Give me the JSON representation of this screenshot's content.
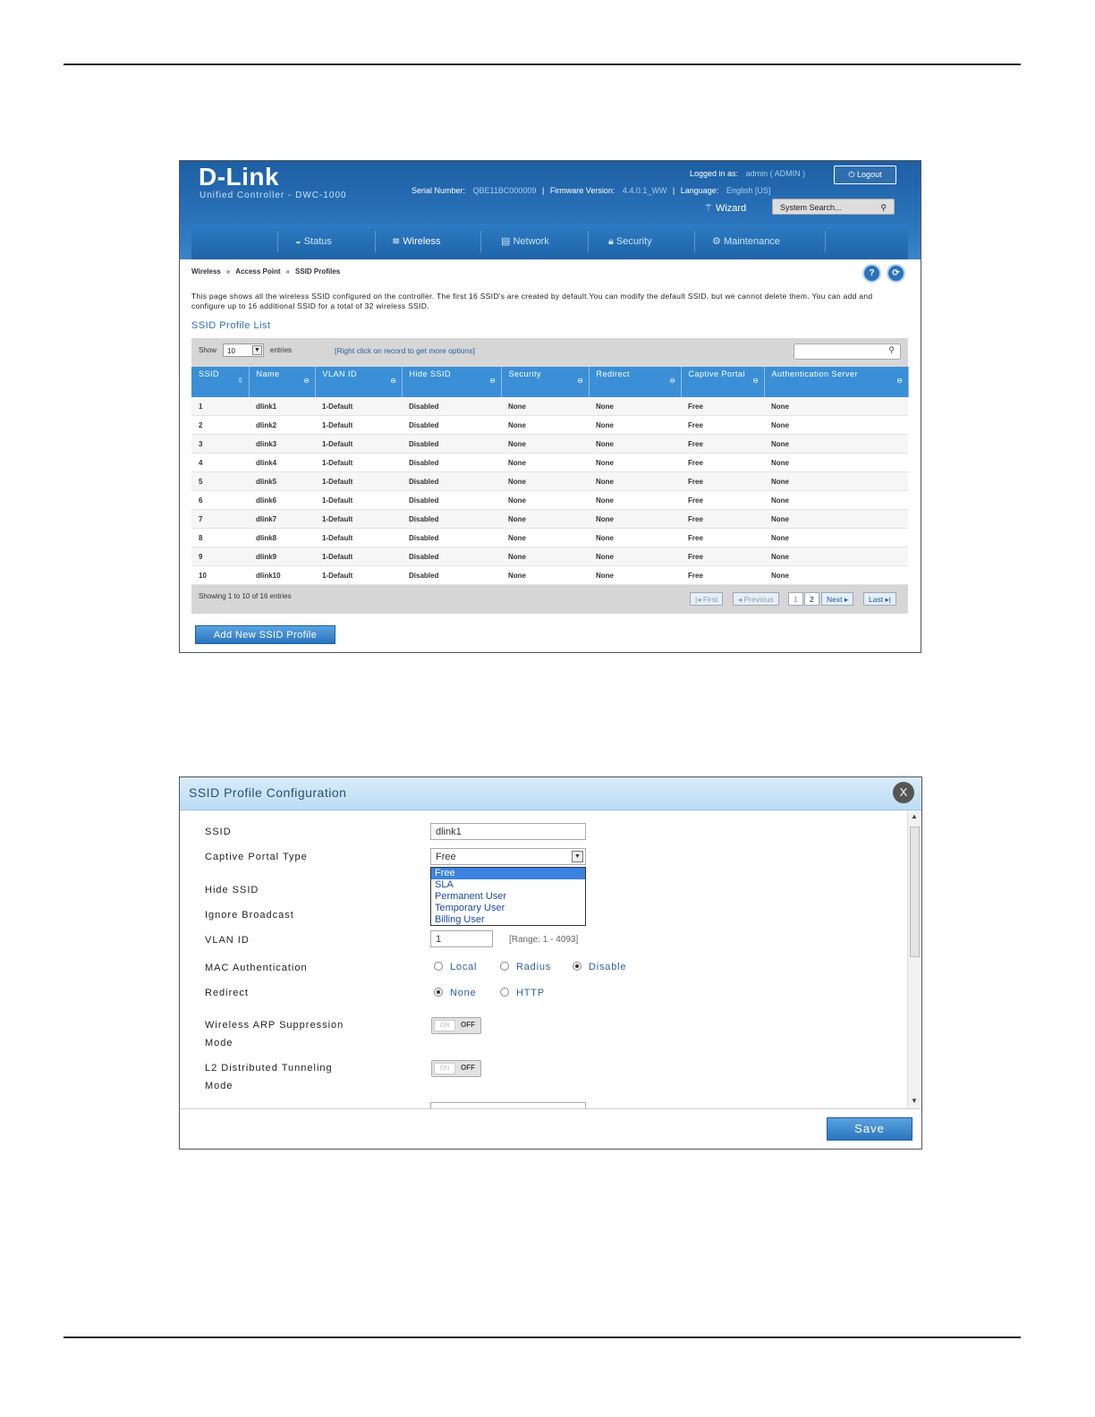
{
  "header": {
    "brand": "D-Link",
    "product": "Unified Controller - DWC-1000",
    "logged_in_label": "Logged in as:",
    "logged_in_user": "admin ( ADMIN )",
    "logout": "Logout",
    "serial_label": "Serial Number:",
    "serial_value": "QBE11BC000009",
    "firmware_label": "Firmware Version:",
    "firmware_value": "4.4.0.1_WW",
    "language_label": "Language:",
    "language_value": "English [US]",
    "wizard": "Wizard",
    "search_placeholder": "System Search..."
  },
  "nav": {
    "items": [
      {
        "label": "Status",
        "icon": "gauge-icon"
      },
      {
        "label": "Wireless",
        "icon": "wifi-icon"
      },
      {
        "label": "Network",
        "icon": "network-icon"
      },
      {
        "label": "Security",
        "icon": "lock-icon"
      },
      {
        "label": "Maintenance",
        "icon": "gear-icon"
      }
    ],
    "active": "Wireless"
  },
  "breadcrumb": [
    "Wireless",
    "Access Point",
    "SSID Profiles"
  ],
  "description": "This page shows all the wireless SSID configured on the controller. The first 16 SSID's are created by default.You can modify the default SSID, but we cannot delete them. You can add and configure up to 16 additional SSID for a total of 32 wireless SSID.",
  "list": {
    "title": "SSID Profile List",
    "show_label": "Show",
    "show_value": "10",
    "entries_label": "entries",
    "hint": "[Right click on record to get more options]",
    "columns": [
      "SSID",
      "Name",
      "VLAN ID",
      "Hide SSID",
      "Security",
      "Redirect",
      "Captive Portal",
      "Authentication Server"
    ],
    "rows": [
      [
        "1",
        "dlink1",
        "1-Default",
        "Disabled",
        "None",
        "None",
        "Free",
        "None"
      ],
      [
        "2",
        "dlink2",
        "1-Default",
        "Disabled",
        "None",
        "None",
        "Free",
        "None"
      ],
      [
        "3",
        "dlink3",
        "1-Default",
        "Disabled",
        "None",
        "None",
        "Free",
        "None"
      ],
      [
        "4",
        "dlink4",
        "1-Default",
        "Disabled",
        "None",
        "None",
        "Free",
        "None"
      ],
      [
        "5",
        "dlink5",
        "1-Default",
        "Disabled",
        "None",
        "None",
        "Free",
        "None"
      ],
      [
        "6",
        "dlink6",
        "1-Default",
        "Disabled",
        "None",
        "None",
        "Free",
        "None"
      ],
      [
        "7",
        "dlink7",
        "1-Default",
        "Disabled",
        "None",
        "None",
        "Free",
        "None"
      ],
      [
        "8",
        "dlink8",
        "1-Default",
        "Disabled",
        "None",
        "None",
        "Free",
        "None"
      ],
      [
        "9",
        "dlink9",
        "1-Default",
        "Disabled",
        "None",
        "None",
        "Free",
        "None"
      ],
      [
        "10",
        "dlink10",
        "1-Default",
        "Disabled",
        "None",
        "None",
        "Free",
        "None"
      ]
    ],
    "showing": "Showing 1 to 10 of 16 entries",
    "pager": {
      "first": "First",
      "previous": "Previous",
      "page1": "1",
      "page2": "2",
      "next": "Next",
      "last": "Last"
    },
    "add_button": "Add New SSID Profile"
  },
  "dialog": {
    "title": "SSID Profile Configuration",
    "close": "X",
    "ssid_label": "SSID",
    "ssid_value": "dlink1",
    "captive_label": "Captive Portal Type",
    "captive_value": "Free",
    "captive_options": [
      "Free",
      "SLA",
      "Permanent User",
      "Temporary User",
      "Billing User"
    ],
    "hide_ssid_label": "Hide SSID",
    "ignore_broadcast_label": "Ignore Broadcast",
    "vlan_label": "VLAN ID",
    "vlan_value": "1",
    "vlan_range": "[Range: 1 - 4093]",
    "mac_auth_label": "MAC Authentication",
    "mac_auth_options": [
      "Local",
      "Radius",
      "Disable"
    ],
    "mac_auth_selected": "Disable",
    "redirect_label": "Redirect",
    "redirect_options": [
      "None",
      "HTTP"
    ],
    "redirect_selected": "None",
    "arp_label_1": "Wireless ARP Suppression",
    "arp_label_2": "Mode",
    "l2_label_1": "L2 Distributed Tunneling",
    "l2_label_2": "Mode",
    "toggle_on": "ON",
    "toggle_off": "OFF",
    "save": "Save"
  },
  "colors": {
    "brand_blue": "#2a73bb",
    "header_blue": "#1d5fa3",
    "table_header": "#3a8fd6",
    "dialog_header": "#bcdcf5"
  }
}
